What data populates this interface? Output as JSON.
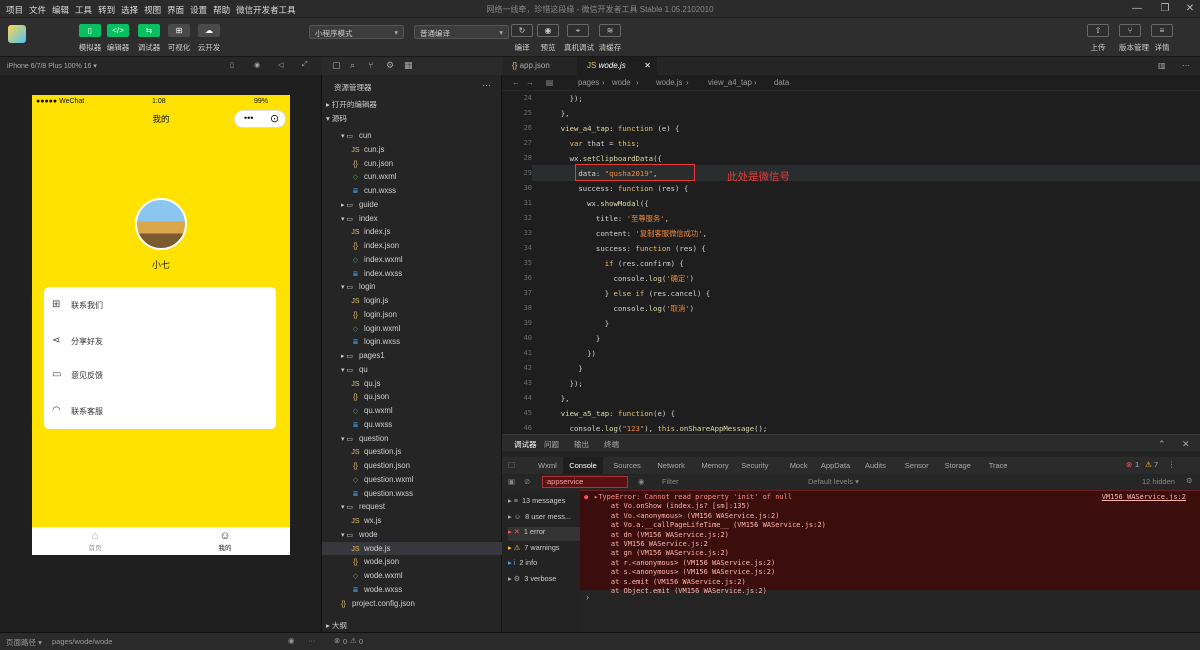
{
  "titlebar": {
    "menus": [
      "项目",
      "文件",
      "编辑",
      "工具",
      "转到",
      "选择",
      "视图",
      "界面",
      "设置",
      "帮助",
      "微信开发者工具"
    ],
    "window_title": "网络一线牵，珍惜这段缘 - 微信开发者工具 Stable 1.05.2102010"
  },
  "toolbar": {
    "left_buttons": [
      {
        "label": "模拟器",
        "icon": "phone-icon"
      },
      {
        "label": "编辑器",
        "icon": "code-icon"
      },
      {
        "label": "调试器",
        "icon": "debug-icon"
      },
      {
        "label": "可视化",
        "icon": "visual-icon"
      },
      {
        "label": "云开发",
        "icon": "cloud-icon"
      }
    ],
    "mode_select": "小程序模式",
    "compile_select": "普通编译",
    "center_buttons": [
      "编译",
      "预览",
      "真机调试",
      "清缓存"
    ],
    "right_buttons": [
      "上传",
      "版本管理",
      "详情"
    ]
  },
  "simulator": {
    "device": "iPhone 6/7/8 Plus 100% 16 ▾",
    "carrier": "●●●●● WeChat",
    "time": "1:08",
    "battery": "99%",
    "nav_title": "我的",
    "username": "小七",
    "menu_items": [
      {
        "icon": "grid-icon",
        "label": "联系我们"
      },
      {
        "icon": "share-icon",
        "label": "分享好友"
      },
      {
        "icon": "chat-icon",
        "label": "意见反馈"
      },
      {
        "icon": "headset-icon",
        "label": "联系客服"
      }
    ],
    "tabbar": {
      "home": "首页",
      "mine": "我的"
    }
  },
  "explorer": {
    "header": "资源管理器",
    "sections": [
      "打开的编辑器",
      "源码"
    ],
    "tree": [
      {
        "name": "cun",
        "type": "folder",
        "d": 1
      },
      {
        "name": "cun.js",
        "type": "js",
        "d": 2
      },
      {
        "name": "cun.json",
        "type": "json",
        "d": 2
      },
      {
        "name": "cun.wxml",
        "type": "wxml",
        "d": 2
      },
      {
        "name": "cun.wxss",
        "type": "wxss",
        "d": 2
      },
      {
        "name": "guide",
        "type": "folder-closed",
        "d": 1
      },
      {
        "name": "index",
        "type": "folder",
        "d": 1
      },
      {
        "name": "index.js",
        "type": "js",
        "d": 2
      },
      {
        "name": "index.json",
        "type": "json",
        "d": 2
      },
      {
        "name": "index.wxml",
        "type": "wxml",
        "d": 2
      },
      {
        "name": "index.wxss",
        "type": "wxss",
        "d": 2
      },
      {
        "name": "login",
        "type": "folder",
        "d": 1
      },
      {
        "name": "login.js",
        "type": "js",
        "d": 2
      },
      {
        "name": "login.json",
        "type": "json",
        "d": 2
      },
      {
        "name": "login.wxml",
        "type": "wxml",
        "d": 2
      },
      {
        "name": "login.wxss",
        "type": "wxss",
        "d": 2
      },
      {
        "name": "pages1",
        "type": "folder-closed",
        "d": 1
      },
      {
        "name": "qu",
        "type": "folder",
        "d": 1
      },
      {
        "name": "qu.js",
        "type": "js",
        "d": 2
      },
      {
        "name": "qu.json",
        "type": "json",
        "d": 2
      },
      {
        "name": "qu.wxml",
        "type": "wxml",
        "d": 2
      },
      {
        "name": "qu.wxss",
        "type": "wxss",
        "d": 2
      },
      {
        "name": "question",
        "type": "folder",
        "d": 1
      },
      {
        "name": "question.js",
        "type": "js",
        "d": 2
      },
      {
        "name": "question.json",
        "type": "json",
        "d": 2
      },
      {
        "name": "question.wxml",
        "type": "wxml",
        "d": 2
      },
      {
        "name": "question.wxss",
        "type": "wxss",
        "d": 2
      },
      {
        "name": "request",
        "type": "folder",
        "d": 1
      },
      {
        "name": "wx.js",
        "type": "js",
        "d": 2
      },
      {
        "name": "wode",
        "type": "folder",
        "d": 1
      },
      {
        "name": "wode.js",
        "type": "js",
        "d": 2,
        "selected": true
      },
      {
        "name": "wode.json",
        "type": "json",
        "d": 2
      },
      {
        "name": "wode.wxml",
        "type": "wxml",
        "d": 2
      },
      {
        "name": "wode.wxss",
        "type": "wxss",
        "d": 2
      },
      {
        "name": "project.config.json",
        "type": "json",
        "d": 1
      },
      {
        "name": "pages1",
        "type": "folder-closed",
        "d": 1
      }
    ],
    "outline": "大纲"
  },
  "editor": {
    "tabs": [
      "app.json",
      "wode.js"
    ],
    "breadcrumb": [
      "pages",
      "wode",
      "wode.js",
      "view_a4_tap",
      "data"
    ],
    "annotation": "此处是微信号",
    "lines": [
      {
        "n": "24",
        "t": "    });"
      },
      {
        "n": "25",
        "t": "  },"
      },
      {
        "n": "26",
        "t": "  view_a4_tap: function (e) {"
      },
      {
        "n": "27",
        "t": "    var that = this;"
      },
      {
        "n": "28",
        "t": "    wx.setClipboardData({"
      },
      {
        "n": "29",
        "t": "      data: \"qusha2019\","
      },
      {
        "n": "30",
        "t": "      success: function (res) {"
      },
      {
        "n": "31",
        "t": "        wx.showModal({"
      },
      {
        "n": "32",
        "t": "          title: '至尊服务',"
      },
      {
        "n": "33",
        "t": "          content: '复制客服微信成功',"
      },
      {
        "n": "34",
        "t": "          success: function (res) {"
      },
      {
        "n": "35",
        "t": "            if (res.confirm) {"
      },
      {
        "n": "36",
        "t": "              console.log('确定')"
      },
      {
        "n": "37",
        "t": "            } else if (res.cancel) {"
      },
      {
        "n": "38",
        "t": "              console.log('取消')"
      },
      {
        "n": "39",
        "t": "            }"
      },
      {
        "n": "40",
        "t": "          }"
      },
      {
        "n": "41",
        "t": "        })"
      },
      {
        "n": "42",
        "t": "      }"
      },
      {
        "n": "43",
        "t": "    });"
      },
      {
        "n": "44",
        "t": "  },"
      },
      {
        "n": "45",
        "t": "  view_a5_tap: function(e) {"
      },
      {
        "n": "46",
        "t": "    console.log(\"123\"), this.onShareAppMessage();"
      }
    ]
  },
  "console": {
    "top_tabs": [
      "调试器",
      "问题",
      "输出",
      "终端"
    ],
    "tabs": [
      "Wxml",
      "Console",
      "Sources",
      "Network",
      "Memory",
      "Security",
      "Mock",
      "AppData",
      "Audits",
      "Sensor",
      "Storage",
      "Trace"
    ],
    "active_tab": "Console",
    "errors": "1",
    "warnings": "7",
    "context": "appservice",
    "filter_placeholder": "Filter",
    "levels": "Default levels ▾",
    "hidden": "12 hidden",
    "side": [
      {
        "icon": "list-icon",
        "label": "13 messages"
      },
      {
        "icon": "user-icon",
        "label": "8 user mess..."
      },
      {
        "icon": "error-icon",
        "label": "1 error"
      },
      {
        "icon": "warning-icon",
        "label": "7 warnings"
      },
      {
        "icon": "info-icon",
        "label": "2 info"
      },
      {
        "icon": "verbose-icon",
        "label": "3 verbose"
      }
    ],
    "error_lines": [
      "▸TypeError: Cannot read property 'init' of null",
      "    at Vo.onShow (index.js? [sm]:135)",
      "    at Vo.<anonymous> (VM156 WAService.js:2)",
      "    at Vo.a.__callPageLifeTime__ (VM156 WAService.js:2)",
      "    at dn (VM156 WAService.js:2)",
      "    at VM156 WAService.js:2",
      "    at gn (VM156 WAService.js:2)",
      "    at r.<anonymous> (VM156 WAService.js:2)",
      "    at s.<anonymous> (VM156 WAService.js:2)",
      "    at s.emit (VM156 WAService.js:2)",
      "    at Object.emit (VM156 WAService.js:2)"
    ],
    "error_source": "VM156 WAService.js:2"
  },
  "statusbar": {
    "path_label": "页面路径 ▾",
    "path": "pages/wode/wode",
    "errors": "0",
    "warnings": "0"
  }
}
